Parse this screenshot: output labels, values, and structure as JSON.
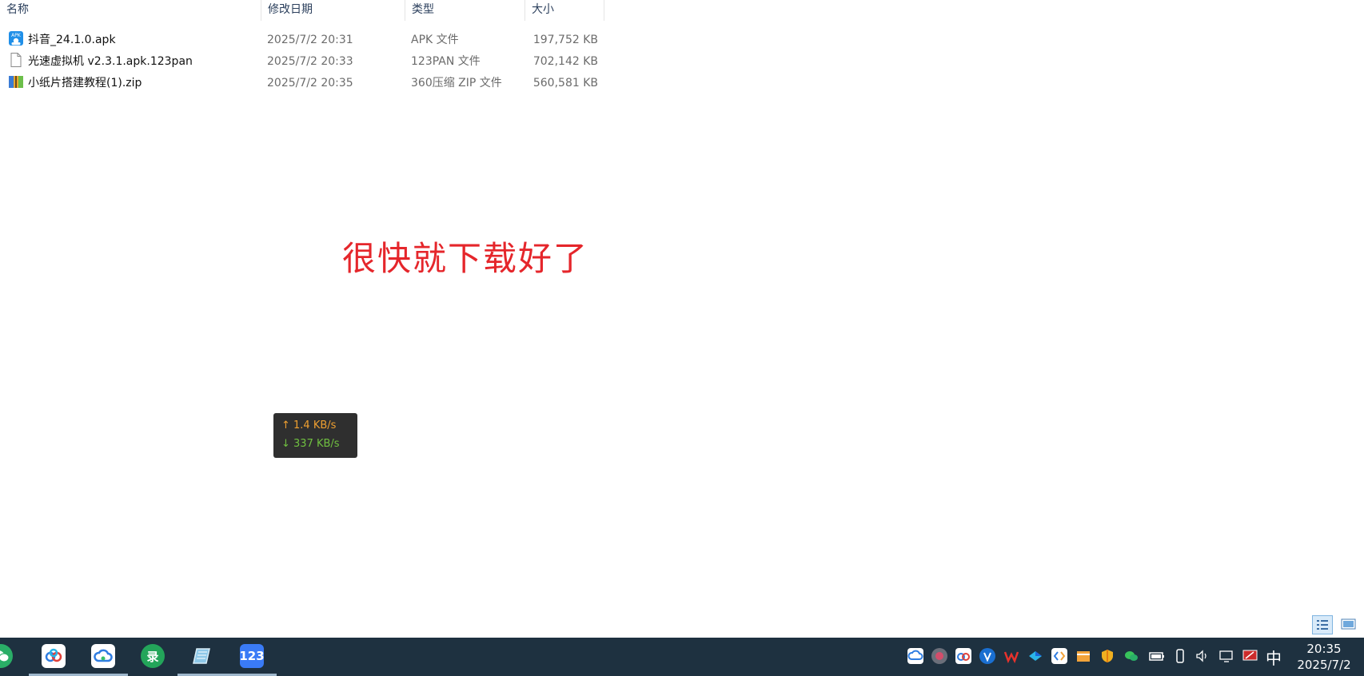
{
  "columns": {
    "name": "名称",
    "date": "修改日期",
    "type": "类型",
    "size": "大小"
  },
  "files": [
    {
      "name": "抖音_24.1.0.apk",
      "date": "2025/7/2 20:31",
      "type": "APK 文件",
      "size": "197,752 KB",
      "icon": "apk-icon"
    },
    {
      "name": "光速虚拟机 v2.3.1.apk.123pan",
      "date": "2025/7/2 20:33",
      "type": "123PAN 文件",
      "size": "702,142 KB",
      "icon": "file-icon"
    },
    {
      "name": "小纸片搭建教程(1).zip",
      "date": "2025/7/2 20:35",
      "type": "360压缩 ZIP 文件",
      "size": "560,581 KB",
      "icon": "zip-icon"
    }
  ],
  "caption": "很快就下载好了",
  "netspeed": {
    "up": "↑ 1.4 KB/s",
    "down": "↓ 337 KB/s"
  },
  "taskbar": {
    "apps": [
      {
        "name": "wechat-app",
        "label": ""
      },
      {
        "name": "baidu-netdisk-app",
        "label": ""
      },
      {
        "name": "cloud-drive-app",
        "label": ""
      },
      {
        "name": "recorder-app",
        "label": "录"
      },
      {
        "name": "notebook-app",
        "label": ""
      },
      {
        "name": "pan123-app",
        "label": "123"
      }
    ],
    "ime": "中",
    "time": "20:35",
    "date": "2025/7/2"
  },
  "colors": {
    "caption": "#e5262b",
    "taskbar": "#1e3140",
    "upload": "#f0a030",
    "download": "#70c040"
  }
}
